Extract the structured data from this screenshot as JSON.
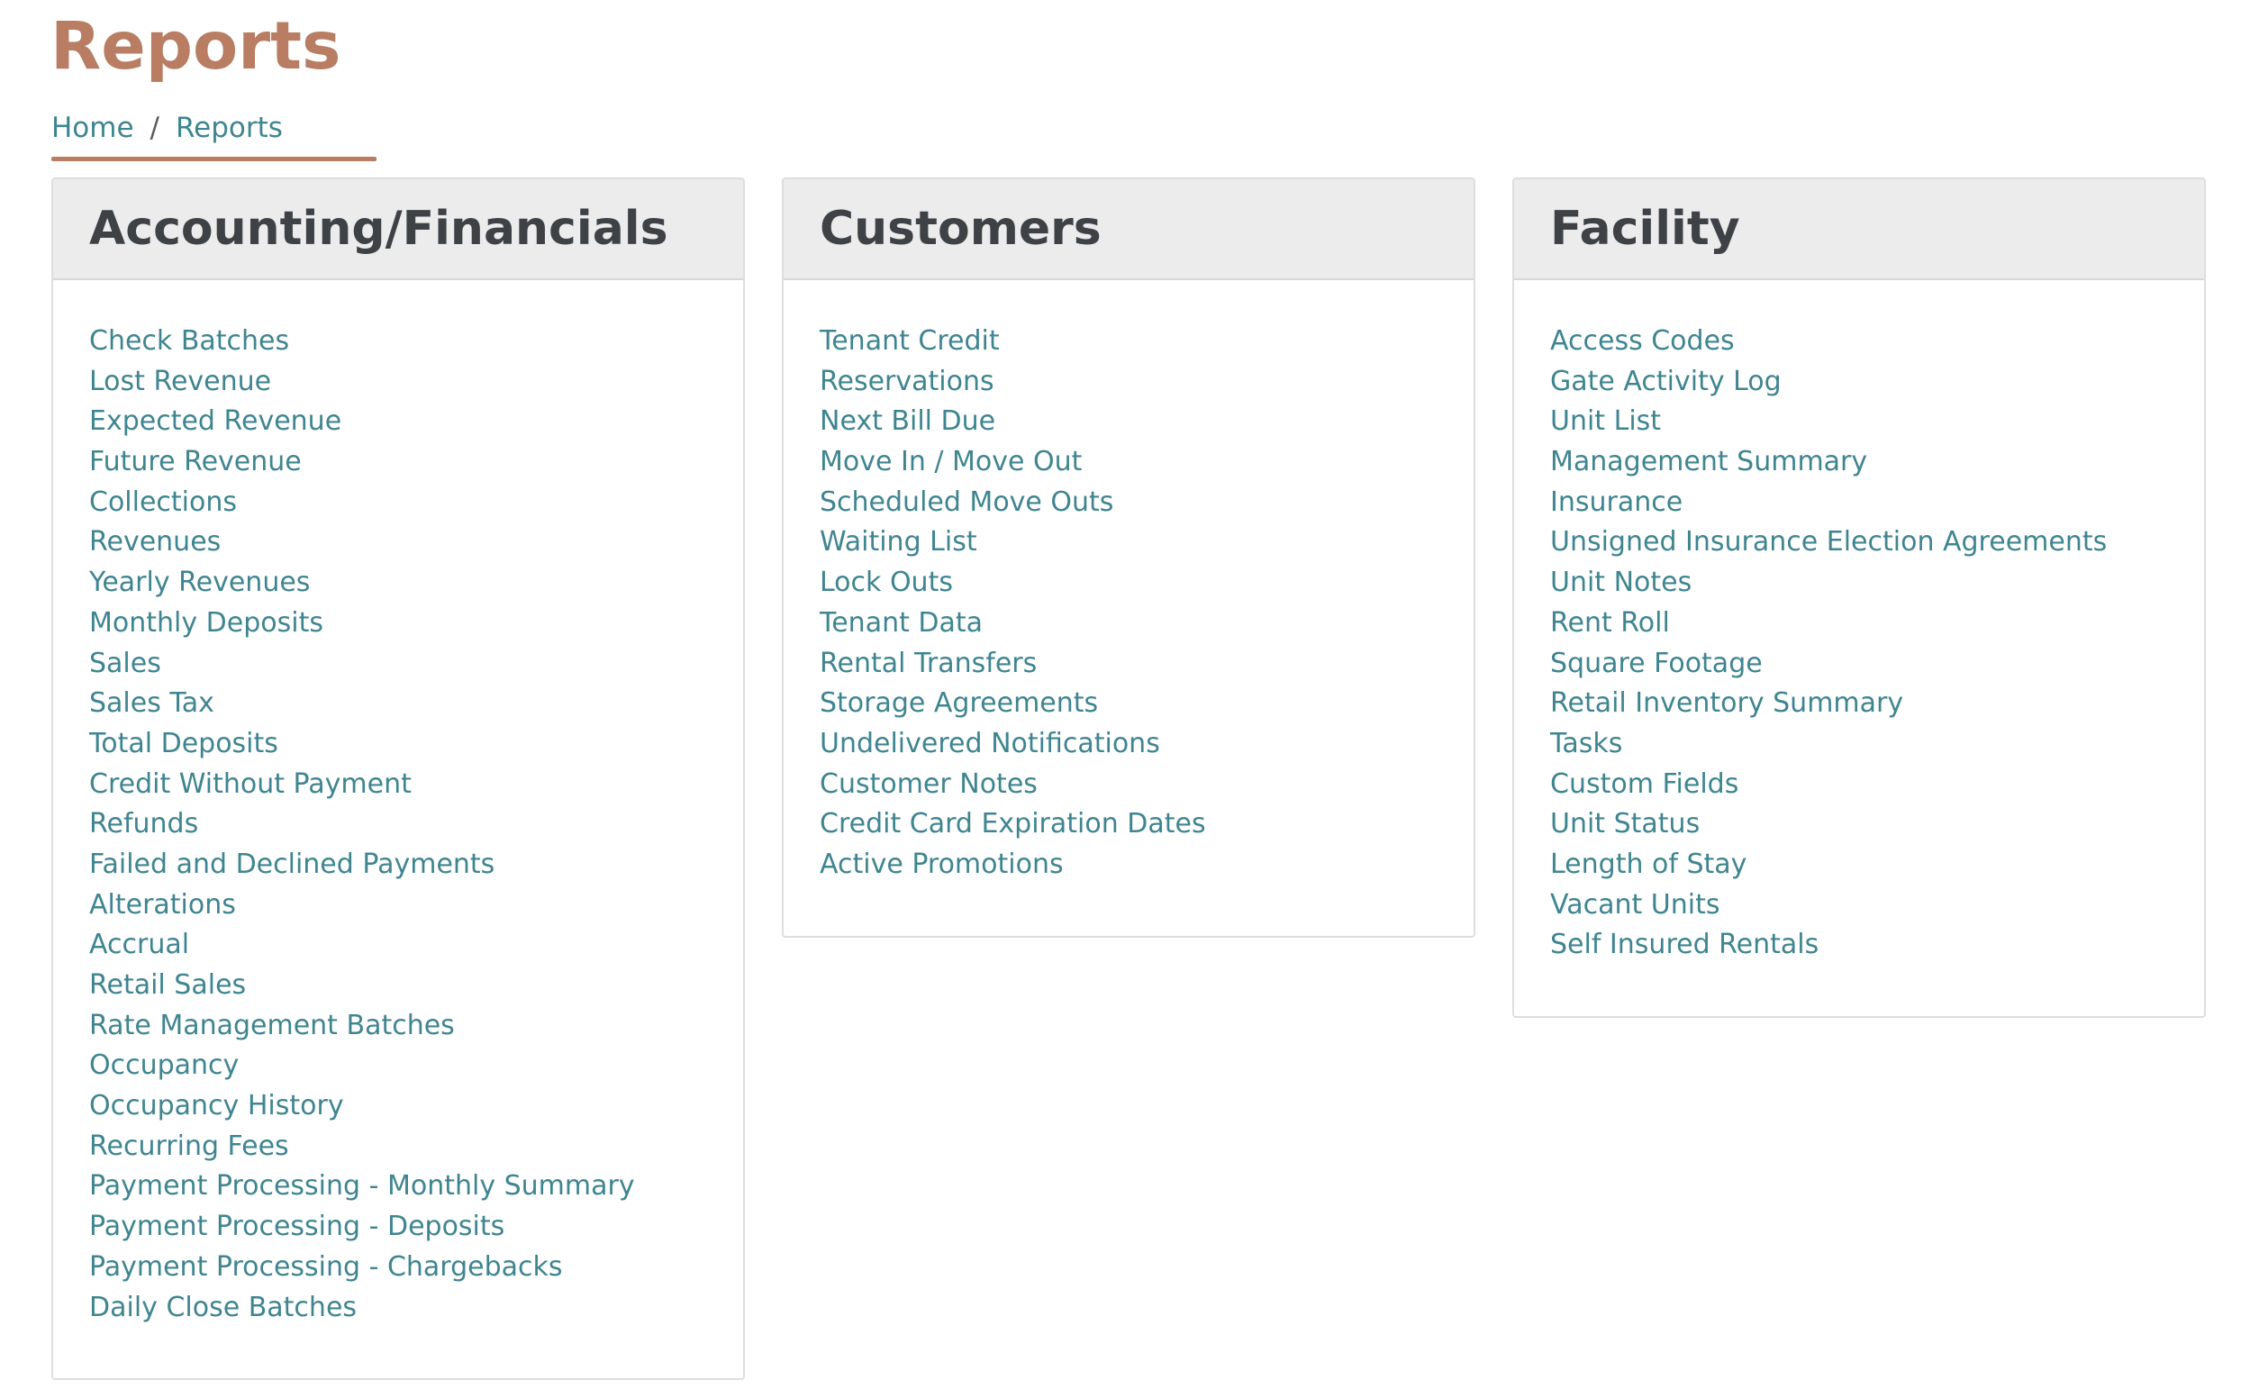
{
  "page": {
    "title": "Reports"
  },
  "breadcrumb": {
    "home": "Home",
    "separator": "/",
    "current": "Reports"
  },
  "colors": {
    "title": "#b87d62",
    "link": "#3f8590",
    "panel_header_bg": "#ececec",
    "panel_title": "#3e4247",
    "border": "#dedede"
  },
  "panels": [
    {
      "title": "Accounting/Financials",
      "items": [
        "Check Batches",
        "Lost Revenue",
        "Expected Revenue",
        "Future Revenue",
        "Collections",
        "Revenues",
        "Yearly Revenues",
        "Monthly Deposits",
        "Sales",
        "Sales Tax",
        "Total Deposits",
        "Credit Without Payment",
        "Refunds",
        "Failed and Declined Payments",
        "Alterations",
        "Accrual",
        "Retail Sales",
        "Rate Management Batches",
        "Occupancy",
        "Occupancy History",
        "Recurring Fees",
        "Payment Processing - Monthly Summary",
        "Payment Processing - Deposits",
        "Payment Processing - Chargebacks",
        "Daily Close Batches"
      ]
    },
    {
      "title": "Customers",
      "items": [
        "Tenant Credit",
        "Reservations",
        "Next Bill Due",
        "Move In / Move Out",
        "Scheduled Move Outs",
        "Waiting List",
        "Lock Outs",
        "Tenant Data",
        "Rental Transfers",
        "Storage Agreements",
        "Undelivered Notifications",
        "Customer Notes",
        "Credit Card Expiration Dates",
        "Active Promotions"
      ]
    },
    {
      "title": "Facility",
      "items": [
        "Access Codes",
        "Gate Activity Log",
        "Unit List",
        "Management Summary",
        "Insurance",
        "Unsigned Insurance Election Agreements",
        "Unit Notes",
        "Rent Roll",
        "Square Footage",
        "Retail Inventory Summary",
        "Tasks",
        "Custom Fields",
        "Unit Status",
        "Length of Stay",
        "Vacant Units",
        "Self Insured Rentals"
      ]
    }
  ]
}
